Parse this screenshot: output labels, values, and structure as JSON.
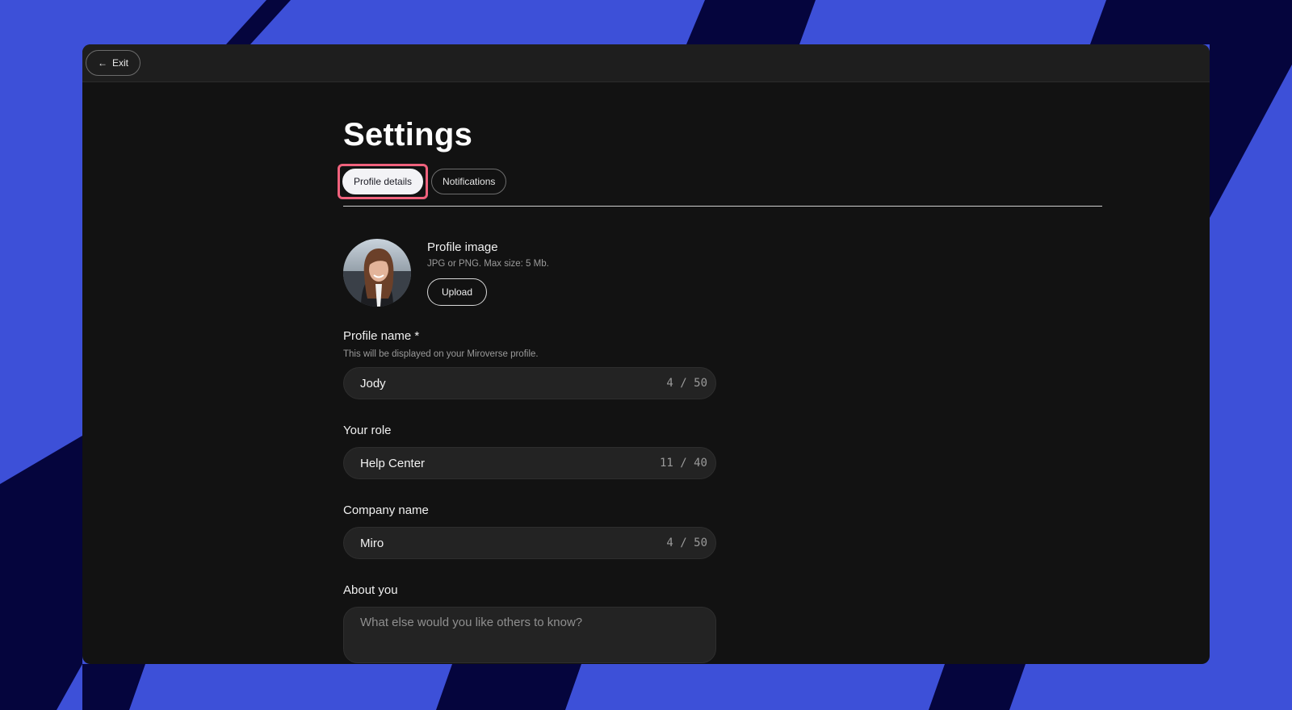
{
  "colors": {
    "background": "#3d50d8",
    "stripe": "#05053d",
    "window": "#121212",
    "highlight": "#f0627d"
  },
  "topbar": {
    "exit_label": "Exit",
    "exit_icon": "arrow-left-icon"
  },
  "page": {
    "title": "Settings"
  },
  "tabs": [
    {
      "label": "Profile details",
      "active": true
    },
    {
      "label": "Notifications",
      "active": false
    }
  ],
  "profile_image": {
    "title": "Profile image",
    "hint": "JPG or PNG. Max size: 5 Mb.",
    "upload_label": "Upload"
  },
  "fields": {
    "profile_name": {
      "label": "Profile name *",
      "help": "This will be displayed on your Miroverse profile.",
      "value": "Jody",
      "counter": "4 / 50"
    },
    "role": {
      "label": "Your role",
      "value": "Help Center",
      "counter": "11 / 40"
    },
    "company": {
      "label": "Company name",
      "value": "Miro",
      "counter": "4 / 50"
    },
    "about": {
      "label": "About you",
      "placeholder": "What else would you like others to know?"
    }
  }
}
